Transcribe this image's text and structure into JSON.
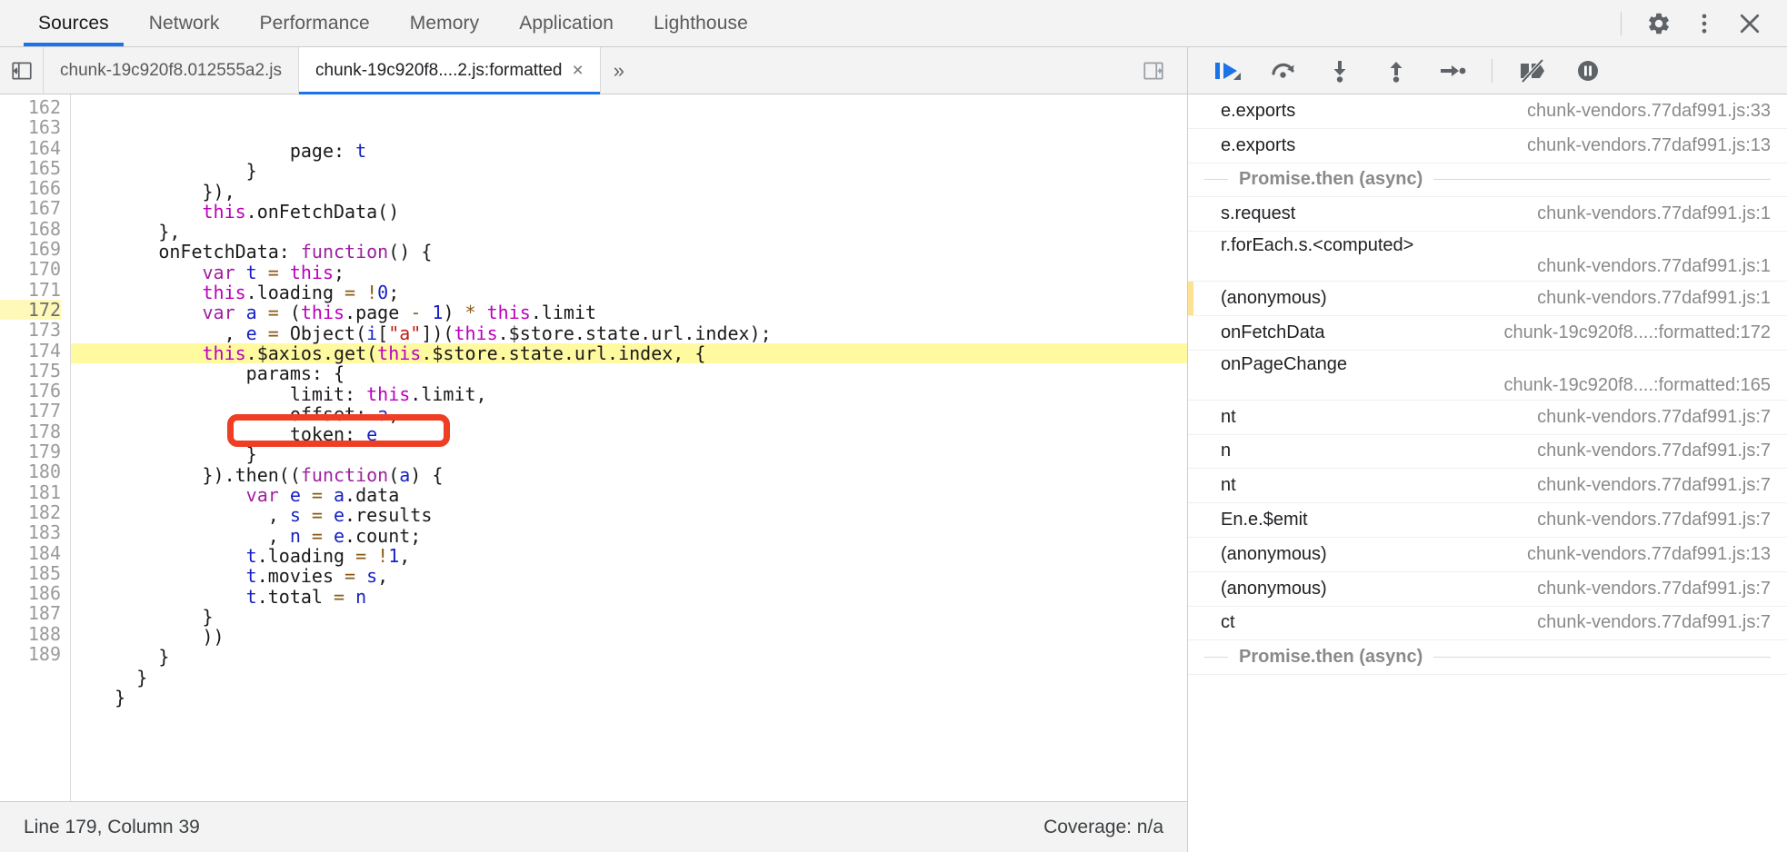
{
  "window": {
    "panel_tabs": [
      {
        "label": "Sources",
        "active": true
      },
      {
        "label": "Network",
        "active": false
      },
      {
        "label": "Performance",
        "active": false
      },
      {
        "label": "Memory",
        "active": false
      },
      {
        "label": "Application",
        "active": false
      },
      {
        "label": "Lighthouse",
        "active": false
      }
    ],
    "actions": [
      {
        "name": "settings-icon",
        "title": "Settings"
      },
      {
        "name": "more-options-icon",
        "title": "Customize and control DevTools"
      },
      {
        "name": "close-icon",
        "title": "Close DevTools"
      }
    ]
  },
  "editor": {
    "navigator_toggle": "show-navigator",
    "file_tabs": [
      {
        "label": "chunk-19c920f8.012555a2.js",
        "active": false,
        "closable": false
      },
      {
        "label": "chunk-19c920f8....2.js:formatted",
        "active": true,
        "closable": true,
        "close_glyph": "×"
      }
    ],
    "more_tabs_glyph": "»",
    "pretty_print_toggle": "show-source-tabs",
    "highlighted_line": 172,
    "first_line": 162,
    "lines": [
      {
        "n": 162,
        "text": "                    page: t",
        "tokens": [
          {
            "t": "                    ",
            "c": "t-pl"
          },
          {
            "t": "page",
            "c": "t-pl"
          },
          {
            "t": ": ",
            "c": "t-pl"
          },
          {
            "t": "t",
            "c": "t-var"
          }
        ]
      },
      {
        "n": 163,
        "text": "                }",
        "tokens": [
          {
            "t": "                }",
            "c": "t-pl"
          }
        ]
      },
      {
        "n": 164,
        "text": "            }),",
        "tokens": [
          {
            "t": "            }),",
            "c": "t-pl"
          }
        ]
      },
      {
        "n": 165,
        "text": "            this.onFetchData()",
        "tokens": [
          {
            "t": "            ",
            "c": "t-pl"
          },
          {
            "t": "this",
            "c": "t-this"
          },
          {
            "t": ".onFetchData()",
            "c": "t-pl"
          }
        ]
      },
      {
        "n": 166,
        "text": "        },",
        "tokens": [
          {
            "t": "        },",
            "c": "t-pl"
          }
        ]
      },
      {
        "n": 167,
        "text": "        onFetchData: function() {",
        "tokens": [
          {
            "t": "        onFetchData: ",
            "c": "t-pl"
          },
          {
            "t": "function",
            "c": "t-kw"
          },
          {
            "t": "() {",
            "c": "t-pl"
          }
        ]
      },
      {
        "n": 168,
        "text": "            var t = this;",
        "tokens": [
          {
            "t": "            ",
            "c": "t-pl"
          },
          {
            "t": "var",
            "c": "t-kw"
          },
          {
            "t": " ",
            "c": "t-pl"
          },
          {
            "t": "t",
            "c": "t-var"
          },
          {
            "t": " = ",
            "c": "t-op"
          },
          {
            "t": "this",
            "c": "t-this"
          },
          {
            "t": ";",
            "c": "t-pl"
          }
        ]
      },
      {
        "n": 169,
        "text": "            this.loading = !0;",
        "tokens": [
          {
            "t": "            ",
            "c": "t-pl"
          },
          {
            "t": "this",
            "c": "t-this"
          },
          {
            "t": ".loading ",
            "c": "t-pl"
          },
          {
            "t": "= !",
            "c": "t-op"
          },
          {
            "t": "0",
            "c": "t-num"
          },
          {
            "t": ";",
            "c": "t-pl"
          }
        ]
      },
      {
        "n": 170,
        "text": "            var a = (this.page - 1) * this.limit",
        "tokens": [
          {
            "t": "            ",
            "c": "t-pl"
          },
          {
            "t": "var",
            "c": "t-kw"
          },
          {
            "t": " ",
            "c": "t-pl"
          },
          {
            "t": "a",
            "c": "t-var"
          },
          {
            "t": " = ",
            "c": "t-op"
          },
          {
            "t": "(",
            "c": "t-pl"
          },
          {
            "t": "this",
            "c": "t-this"
          },
          {
            "t": ".page ",
            "c": "t-pl"
          },
          {
            "t": "- ",
            "c": "t-op"
          },
          {
            "t": "1",
            "c": "t-num"
          },
          {
            "t": ") ",
            "c": "t-pl"
          },
          {
            "t": "* ",
            "c": "t-op"
          },
          {
            "t": "this",
            "c": "t-this"
          },
          {
            "t": ".limit",
            "c": "t-pl"
          }
        ]
      },
      {
        "n": 171,
        "text": "              , e = Object(i[\"a\"])(this.$store.state.url.index);",
        "tokens": [
          {
            "t": "              , ",
            "c": "t-pl"
          },
          {
            "t": "e",
            "c": "t-var"
          },
          {
            "t": " = ",
            "c": "t-op"
          },
          {
            "t": "Object(",
            "c": "t-pl"
          },
          {
            "t": "i",
            "c": "t-var"
          },
          {
            "t": "[",
            "c": "t-pl"
          },
          {
            "t": "\"a\"",
            "c": "t-str"
          },
          {
            "t": "])(",
            "c": "t-pl"
          },
          {
            "t": "this",
            "c": "t-this"
          },
          {
            "t": ".$store.state.url.index);",
            "c": "t-pl"
          }
        ]
      },
      {
        "n": 172,
        "text": "            this.$axios.get(this.$store.state.url.index, {",
        "tokens": [
          {
            "t": "            ",
            "c": "t-pl"
          },
          {
            "t": "this",
            "c": "t-this"
          },
          {
            "t": ".$axios.get(",
            "c": "t-pl"
          },
          {
            "t": "this",
            "c": "t-this"
          },
          {
            "t": ".$store.state.url.index, {",
            "c": "t-pl"
          }
        ],
        "highlighted": true
      },
      {
        "n": 173,
        "text": "                params: {",
        "tokens": [
          {
            "t": "                params: {",
            "c": "t-pl"
          }
        ]
      },
      {
        "n": 174,
        "text": "                    limit: this.limit,",
        "tokens": [
          {
            "t": "                    limit: ",
            "c": "t-pl"
          },
          {
            "t": "this",
            "c": "t-this"
          },
          {
            "t": ".limit,",
            "c": "t-pl"
          }
        ]
      },
      {
        "n": 175,
        "text": "                    offset: a,",
        "tokens": [
          {
            "t": "                    offset: ",
            "c": "t-pl"
          },
          {
            "t": "a",
            "c": "t-var"
          },
          {
            "t": ",",
            "c": "t-pl"
          }
        ]
      },
      {
        "n": 176,
        "text": "                    token: e",
        "tokens": [
          {
            "t": "                    token: ",
            "c": "t-pl"
          },
          {
            "t": "e",
            "c": "t-var"
          }
        ]
      },
      {
        "n": 177,
        "text": "                }",
        "tokens": [
          {
            "t": "                }",
            "c": "t-pl"
          }
        ]
      },
      {
        "n": 178,
        "text": "            }).then((function(a) {",
        "tokens": [
          {
            "t": "            }).then((",
            "c": "t-pl"
          },
          {
            "t": "function",
            "c": "t-kw"
          },
          {
            "t": "(",
            "c": "t-pl"
          },
          {
            "t": "a",
            "c": "t-var"
          },
          {
            "t": ") {",
            "c": "t-pl"
          }
        ]
      },
      {
        "n": 179,
        "text": "                var e = a.data",
        "tokens": [
          {
            "t": "                ",
            "c": "t-pl"
          },
          {
            "t": "var",
            "c": "t-kw"
          },
          {
            "t": " ",
            "c": "t-pl"
          },
          {
            "t": "e",
            "c": "t-var"
          },
          {
            "t": " = ",
            "c": "t-op"
          },
          {
            "t": "a",
            "c": "t-var"
          },
          {
            "t": ".data",
            "c": "t-pl"
          }
        ]
      },
      {
        "n": 180,
        "text": "                  , s = e.results",
        "tokens": [
          {
            "t": "                  , ",
            "c": "t-pl"
          },
          {
            "t": "s",
            "c": "t-var"
          },
          {
            "t": " = ",
            "c": "t-op"
          },
          {
            "t": "e",
            "c": "t-var"
          },
          {
            "t": ".results",
            "c": "t-pl"
          }
        ]
      },
      {
        "n": 181,
        "text": "                  , n = e.count;",
        "tokens": [
          {
            "t": "                  , ",
            "c": "t-pl"
          },
          {
            "t": "n",
            "c": "t-var"
          },
          {
            "t": " = ",
            "c": "t-op"
          },
          {
            "t": "e",
            "c": "t-var"
          },
          {
            "t": ".count;",
            "c": "t-pl"
          }
        ]
      },
      {
        "n": 182,
        "text": "                t.loading = !1,",
        "tokens": [
          {
            "t": "                ",
            "c": "t-pl"
          },
          {
            "t": "t",
            "c": "t-var"
          },
          {
            "t": ".loading ",
            "c": "t-pl"
          },
          {
            "t": "= !",
            "c": "t-op"
          },
          {
            "t": "1",
            "c": "t-num"
          },
          {
            "t": ",",
            "c": "t-pl"
          }
        ]
      },
      {
        "n": 183,
        "text": "                t.movies = s,",
        "tokens": [
          {
            "t": "                ",
            "c": "t-pl"
          },
          {
            "t": "t",
            "c": "t-var"
          },
          {
            "t": ".movies ",
            "c": "t-pl"
          },
          {
            "t": "= ",
            "c": "t-op"
          },
          {
            "t": "s",
            "c": "t-var"
          },
          {
            "t": ",",
            "c": "t-pl"
          }
        ]
      },
      {
        "n": 184,
        "text": "                t.total = n",
        "tokens": [
          {
            "t": "                ",
            "c": "t-pl"
          },
          {
            "t": "t",
            "c": "t-var"
          },
          {
            "t": ".total ",
            "c": "t-pl"
          },
          {
            "t": "= ",
            "c": "t-op"
          },
          {
            "t": "n",
            "c": "t-var"
          }
        ]
      },
      {
        "n": 185,
        "text": "            }",
        "tokens": [
          {
            "t": "            }",
            "c": "t-pl"
          }
        ]
      },
      {
        "n": 186,
        "text": "            ))",
        "tokens": [
          {
            "t": "            ))",
            "c": "t-pl"
          }
        ]
      },
      {
        "n": 187,
        "text": "        }",
        "tokens": [
          {
            "t": "        }",
            "c": "t-pl"
          }
        ]
      },
      {
        "n": 188,
        "text": "      }",
        "tokens": [
          {
            "t": "      }",
            "c": "t-pl"
          }
        ]
      },
      {
        "n": 189,
        "text": "    }",
        "tokens": [
          {
            "t": "    }",
            "c": "t-pl"
          }
        ]
      }
    ],
    "annotation": {
      "shape": "rounded-rectangle",
      "color": "#ef3e23",
      "target_text": "then((function(a) {",
      "target_line": 178
    }
  },
  "status_bar": {
    "cursor_position": "Line 179, Column 39",
    "coverage": "Coverage: n/a"
  },
  "debugger": {
    "toolbar": [
      {
        "name": "resume-script-execution-icon",
        "active": true
      },
      {
        "name": "step-over-next-function-call-icon",
        "active": false
      },
      {
        "name": "step-into-next-function-call-icon",
        "active": false
      },
      {
        "name": "step-out-of-current-function-icon",
        "active": false
      },
      {
        "name": "step-icon",
        "active": false
      },
      {
        "name": "deactivate-breakpoints-icon",
        "active": false
      },
      {
        "name": "pause-on-exceptions-icon",
        "active": false
      }
    ],
    "call_stack": [
      {
        "type": "frame",
        "name": "e.exports",
        "source": "chunk-vendors.77daf991.js:33",
        "wrap": false,
        "selected": false
      },
      {
        "type": "frame",
        "name": "e.exports",
        "source": "chunk-vendors.77daf991.js:13",
        "wrap": false,
        "selected": false
      },
      {
        "type": "async",
        "name": "Promise.then (async)"
      },
      {
        "type": "frame",
        "name": "s.request",
        "source": "chunk-vendors.77daf991.js:1",
        "wrap": false,
        "selected": false
      },
      {
        "type": "frame",
        "name": "r.forEach.s.<computed>",
        "source": "chunk-vendors.77daf991.js:1",
        "wrap": true,
        "selected": false
      },
      {
        "type": "frame",
        "name": "(anonymous)",
        "source": "chunk-vendors.77daf991.js:1",
        "wrap": false,
        "selected": true
      },
      {
        "type": "frame",
        "name": "onFetchData",
        "source": "chunk-19c920f8....:formatted:172",
        "wrap": false,
        "selected": false
      },
      {
        "type": "frame",
        "name": "onPageChange",
        "source": "chunk-19c920f8....:formatted:165",
        "wrap": true,
        "selected": false
      },
      {
        "type": "frame",
        "name": "nt",
        "source": "chunk-vendors.77daf991.js:7",
        "wrap": false,
        "selected": false
      },
      {
        "type": "frame",
        "name": "n",
        "source": "chunk-vendors.77daf991.js:7",
        "wrap": false,
        "selected": false
      },
      {
        "type": "frame",
        "name": "nt",
        "source": "chunk-vendors.77daf991.js:7",
        "wrap": false,
        "selected": false
      },
      {
        "type": "frame",
        "name": "En.e.$emit",
        "source": "chunk-vendors.77daf991.js:7",
        "wrap": false,
        "selected": false
      },
      {
        "type": "frame",
        "name": "(anonymous)",
        "source": "chunk-vendors.77daf991.js:13",
        "wrap": false,
        "selected": false
      },
      {
        "type": "frame",
        "name": "(anonymous)",
        "source": "chunk-vendors.77daf991.js:7",
        "wrap": false,
        "selected": false
      },
      {
        "type": "frame",
        "name": "ct",
        "source": "chunk-vendors.77daf991.js:7",
        "wrap": false,
        "selected": false
      },
      {
        "type": "async",
        "name": "Promise.then (async)"
      }
    ]
  },
  "colors": {
    "accent": "#1a73e8",
    "annotation": "#ef3e23",
    "highlight_line": "#fff9a0",
    "chrome_bg": "#f3f3f3"
  }
}
